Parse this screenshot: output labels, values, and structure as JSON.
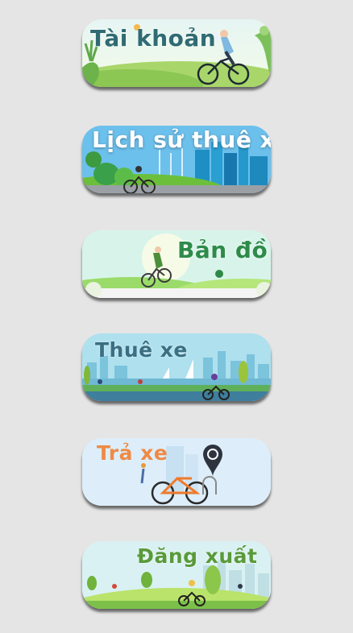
{
  "menu": {
    "items": [
      {
        "label": "Tài khoản"
      },
      {
        "label": "Lịch sử thuê xe"
      },
      {
        "label": "Bản đồ"
      },
      {
        "label": "Thuê xe"
      },
      {
        "label": "Trả xe"
      },
      {
        "label": "Đăng xuất"
      }
    ]
  },
  "colors": {
    "background": "#e5e5e5",
    "account_label": "#2f6b72",
    "history_label": "#ffffff",
    "map_label": "#2e8b4a",
    "rent_label": "#3b6f82",
    "return_label": "#ef8a45",
    "logout_label": "#5a9a3a"
  }
}
